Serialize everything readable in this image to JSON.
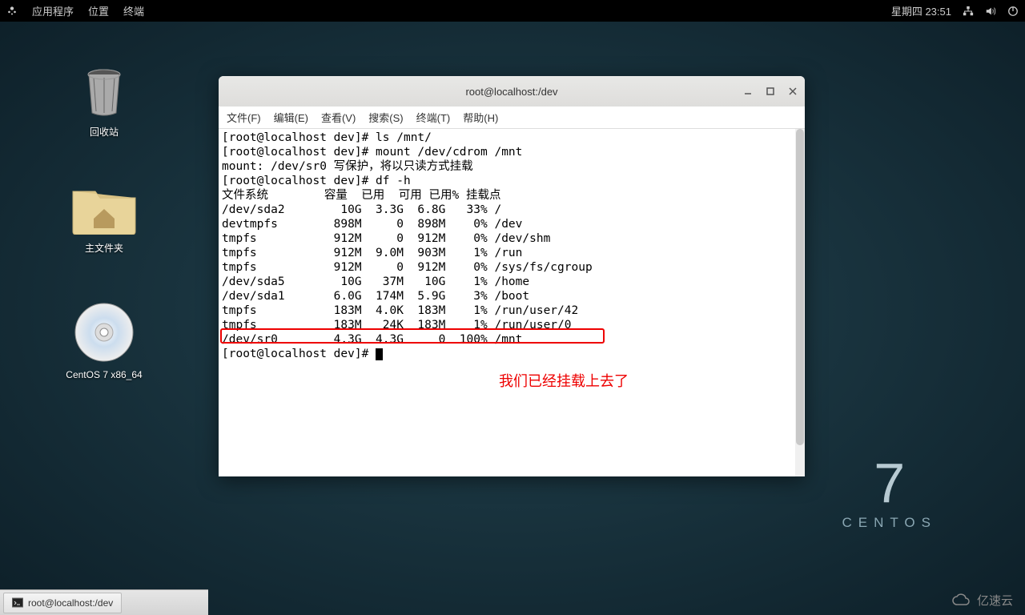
{
  "topbar": {
    "apps": "应用程序",
    "places": "位置",
    "terminal": "终端",
    "datetime": "星期四 23:51"
  },
  "desktop": {
    "trash": "回收站",
    "home": "主文件夹",
    "disc": "CentOS 7 x86_64"
  },
  "brand": {
    "seven": "7",
    "name": "CENTOS"
  },
  "terminal": {
    "title": "root@localhost:/dev",
    "menus": {
      "file": "文件(F)",
      "edit": "编辑(E)",
      "view": "查看(V)",
      "search": "搜索(S)",
      "term": "终端(T)",
      "help": "帮助(H)"
    },
    "lines": [
      "[root@localhost dev]# ls /mnt/",
      "[root@localhost dev]# mount /dev/cdrom /mnt",
      "mount: /dev/sr0 写保护，将以只读方式挂载",
      "[root@localhost dev]# df -h",
      "文件系统        容量  已用  可用 已用% 挂载点",
      "/dev/sda2        10G  3.3G  6.8G   33% /",
      "devtmpfs        898M     0  898M    0% /dev",
      "tmpfs           912M     0  912M    0% /dev/shm",
      "tmpfs           912M  9.0M  903M    1% /run",
      "tmpfs           912M     0  912M    0% /sys/fs/cgroup",
      "/dev/sda5        10G   37M   10G    1% /home",
      "/dev/sda1       6.0G  174M  5.9G    3% /boot",
      "tmpfs           183M  4.0K  183M    1% /run/user/42",
      "tmpfs           183M   24K  183M    1% /run/user/0",
      "/dev/sr0        4.3G  4.3G     0  100% /mnt",
      "[root@localhost dev]# "
    ],
    "annotation": "我们已经挂载上去了"
  },
  "df_data": {
    "header": [
      "文件系统",
      "容量",
      "已用",
      "可用",
      "已用%",
      "挂载点"
    ],
    "rows": [
      {
        "fs": "/dev/sda2",
        "size": "10G",
        "used": "3.3G",
        "avail": "6.8G",
        "pct": "33%",
        "mount": "/"
      },
      {
        "fs": "devtmpfs",
        "size": "898M",
        "used": "0",
        "avail": "898M",
        "pct": "0%",
        "mount": "/dev"
      },
      {
        "fs": "tmpfs",
        "size": "912M",
        "used": "0",
        "avail": "912M",
        "pct": "0%",
        "mount": "/dev/shm"
      },
      {
        "fs": "tmpfs",
        "size": "912M",
        "used": "9.0M",
        "avail": "903M",
        "pct": "1%",
        "mount": "/run"
      },
      {
        "fs": "tmpfs",
        "size": "912M",
        "used": "0",
        "avail": "912M",
        "pct": "0%",
        "mount": "/sys/fs/cgroup"
      },
      {
        "fs": "/dev/sda5",
        "size": "10G",
        "used": "37M",
        "avail": "10G",
        "pct": "1%",
        "mount": "/home"
      },
      {
        "fs": "/dev/sda1",
        "size": "6.0G",
        "used": "174M",
        "avail": "5.9G",
        "pct": "3%",
        "mount": "/boot"
      },
      {
        "fs": "tmpfs",
        "size": "183M",
        "used": "4.0K",
        "avail": "183M",
        "pct": "1%",
        "mount": "/run/user/42"
      },
      {
        "fs": "tmpfs",
        "size": "183M",
        "used": "24K",
        "avail": "183M",
        "pct": "1%",
        "mount": "/run/user/0"
      },
      {
        "fs": "/dev/sr0",
        "size": "4.3G",
        "used": "4.3G",
        "avail": "0",
        "pct": "100%",
        "mount": "/mnt"
      }
    ]
  },
  "taskbar": {
    "task1": "root@localhost:/dev"
  },
  "watermark": "亿速云"
}
